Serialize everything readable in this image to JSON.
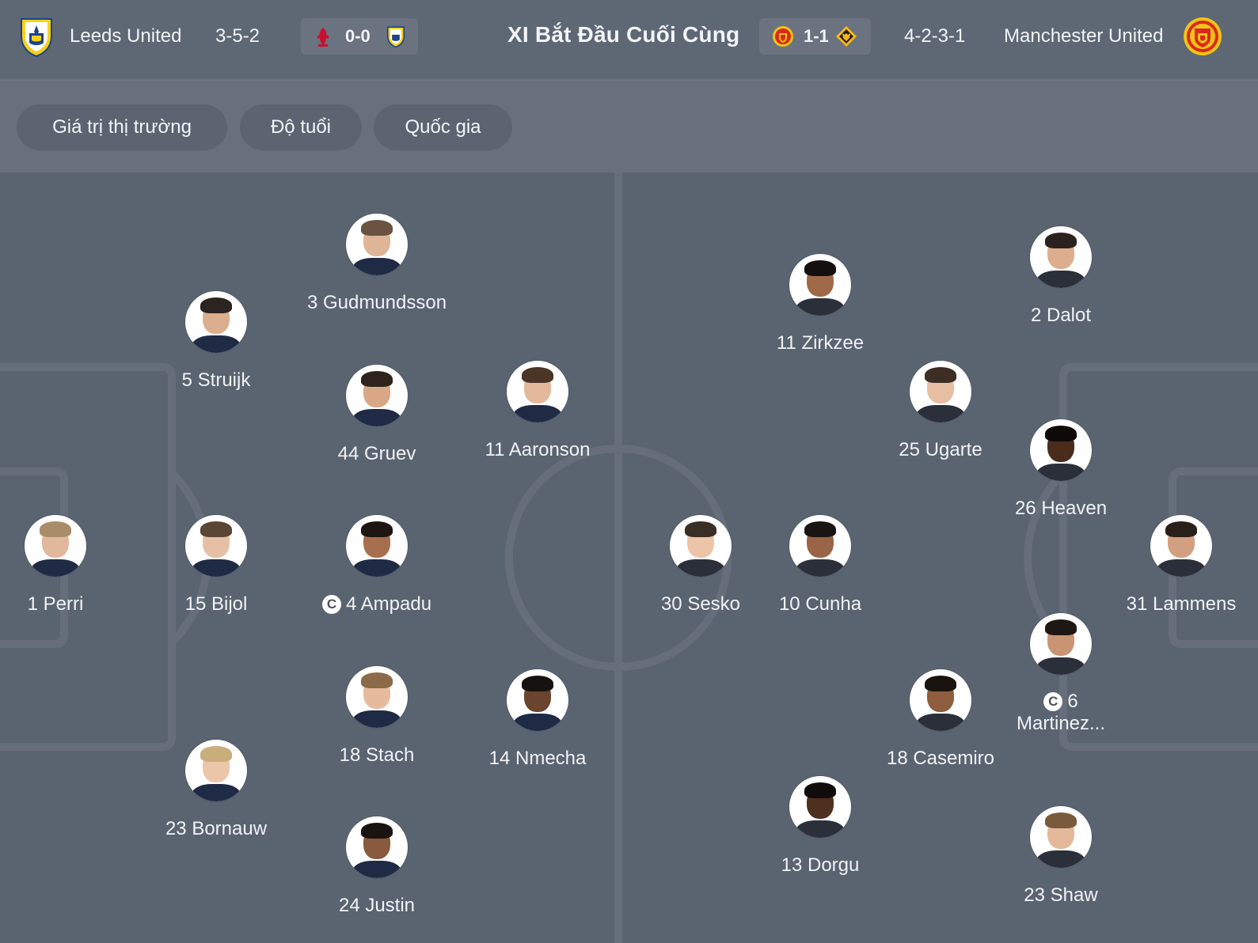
{
  "header": {
    "home_team": "Leeds United",
    "home_formation": "3-5-2",
    "home_last_score": "0-0",
    "title": "XI Bắt Đầu Cuối Cùng",
    "away_last_score": "1-1",
    "away_formation": "4-2-3-1",
    "away_team": "Manchester United"
  },
  "filters": [
    "Giá trị thị trường",
    "Độ tuổi",
    "Quốc gia"
  ],
  "captain_mark": "C",
  "home_players": [
    {
      "label": "1 Perri"
    },
    {
      "label": "15 Bijol"
    },
    {
      "label": "5 Struijk"
    },
    {
      "label": "23 Bornauw"
    },
    {
      "label": "3 Gudmundsson"
    },
    {
      "label": "44 Gruev"
    },
    {
      "label": "4 Ampadu",
      "captain": true
    },
    {
      "label": "18 Stach"
    },
    {
      "label": "24 Justin"
    },
    {
      "label": "11 Aaronson"
    },
    {
      "label": "14 Nmecha"
    }
  ],
  "away_players": [
    {
      "label": "30 Sesko"
    },
    {
      "label": "11 Zirkzee"
    },
    {
      "label": "10 Cunha"
    },
    {
      "label": "13 Dorgu"
    },
    {
      "label": "25 Ugarte"
    },
    {
      "label": "18 Casemiro"
    },
    {
      "label": "2 Dalot"
    },
    {
      "label": "26 Heaven"
    },
    {
      "label": "6",
      "label2": "Martinez...",
      "captain": true
    },
    {
      "label": "23 Shaw"
    },
    {
      "label": "31 Lammens"
    }
  ],
  "colors": {
    "background": "#5a6370",
    "header": "#5e6774",
    "filter_bar": "#67707c",
    "pill": "#5b6470",
    "pitch_lines": "#656e7a",
    "leeds_yellow": "#f7d117",
    "leeds_blue": "#1d428a",
    "united_red": "#da291c",
    "liverpool_red": "#c8102e",
    "wolves_gold": "#fdb913"
  },
  "icons": {
    "home_crest": "leeds-united-crest-icon",
    "away_crest": "manchester-united-crest-icon",
    "home_last_opponent": "liverpool-crest-icon",
    "away_last_opponent": "wolves-crest-icon"
  }
}
